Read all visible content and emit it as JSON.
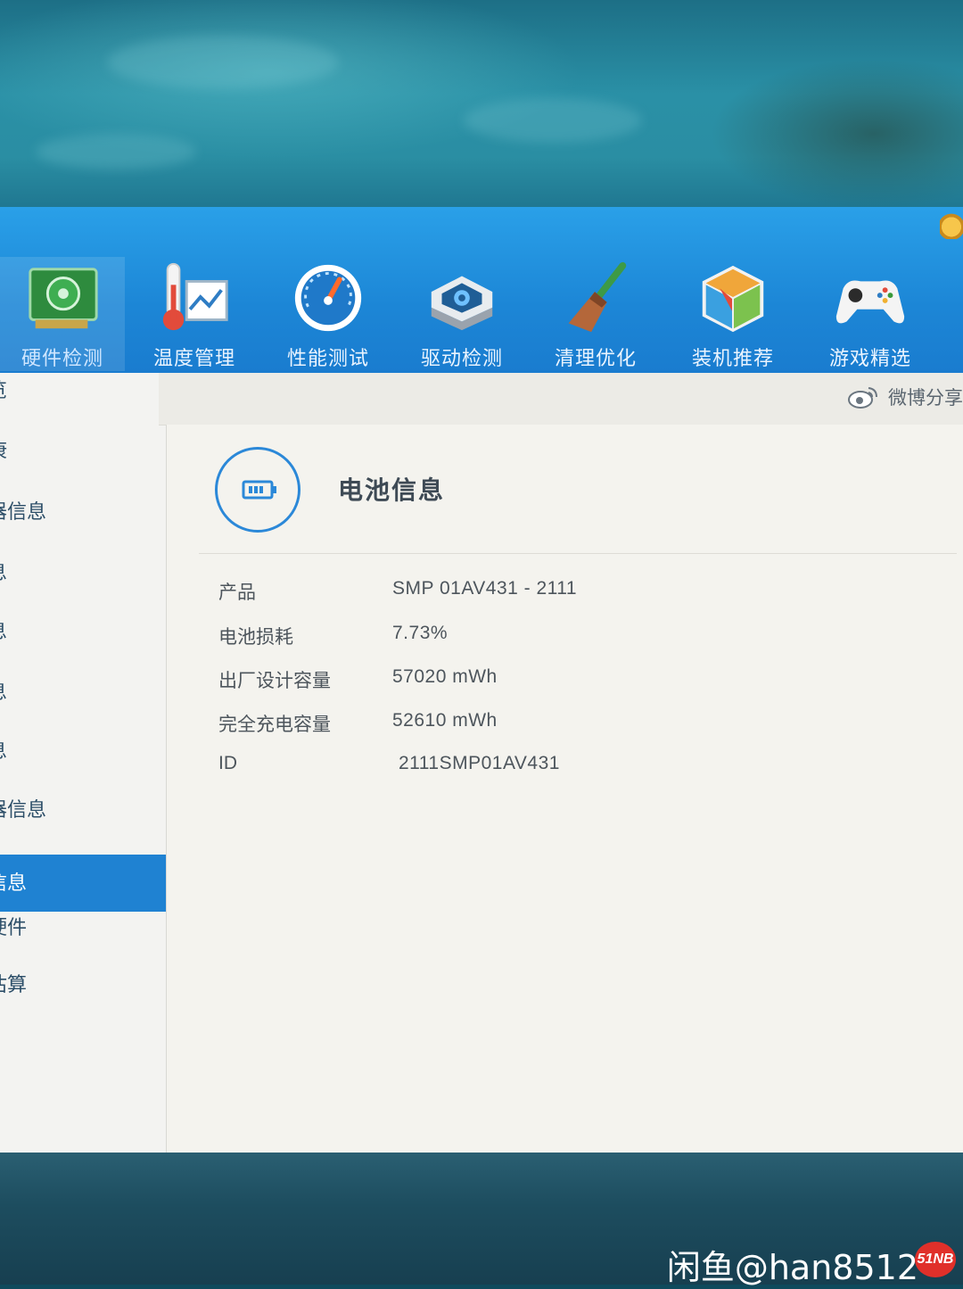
{
  "toolbar": {
    "tabs": [
      {
        "label": "硬件检测",
        "icon": "hardware-card-icon"
      },
      {
        "label": "温度管理",
        "icon": "thermometer-chart-icon"
      },
      {
        "label": "性能测试",
        "icon": "speedometer-icon"
      },
      {
        "label": "驱动检测",
        "icon": "gear-box-icon"
      },
      {
        "label": "清理优化",
        "icon": "broom-icon"
      },
      {
        "label": "装机推荐",
        "icon": "cube-icon"
      },
      {
        "label": "游戏精选",
        "icon": "gamepad-icon"
      }
    ],
    "active_tab": "硬件检测"
  },
  "share": {
    "label": "微博分享",
    "icon": "weibo-icon"
  },
  "sidebar": {
    "items": [
      {
        "label": "览"
      },
      {
        "label": "康"
      },
      {
        "label": "器信息"
      },
      {
        "label": "息"
      },
      {
        "label": "息"
      },
      {
        "label": "息"
      },
      {
        "label": "息"
      },
      {
        "label": "器信息"
      },
      {
        "label": "信息"
      },
      {
        "label": "硬件"
      },
      {
        "label": "估算"
      }
    ],
    "active_index": 8
  },
  "battery": {
    "title": "电池信息",
    "icon": "battery-icon",
    "rows": [
      {
        "key": "产品",
        "value": "SMP 01AV431 -  2111"
      },
      {
        "key": "电池损耗",
        "value": "7.73%"
      },
      {
        "key": "出厂设计容量",
        "value": "57020 mWh"
      },
      {
        "key": "完全充电容量",
        "value": "52610 mWh"
      },
      {
        "key": "ID",
        "value": "2111SMP01AV431"
      }
    ]
  },
  "watermark": {
    "text": "闲鱼@han8512",
    "logo_text": "51NB"
  },
  "colors": {
    "toolbar_blue": "#1c86d6",
    "accent_blue": "#1f82d2",
    "content_bg": "#f4f3ee"
  }
}
